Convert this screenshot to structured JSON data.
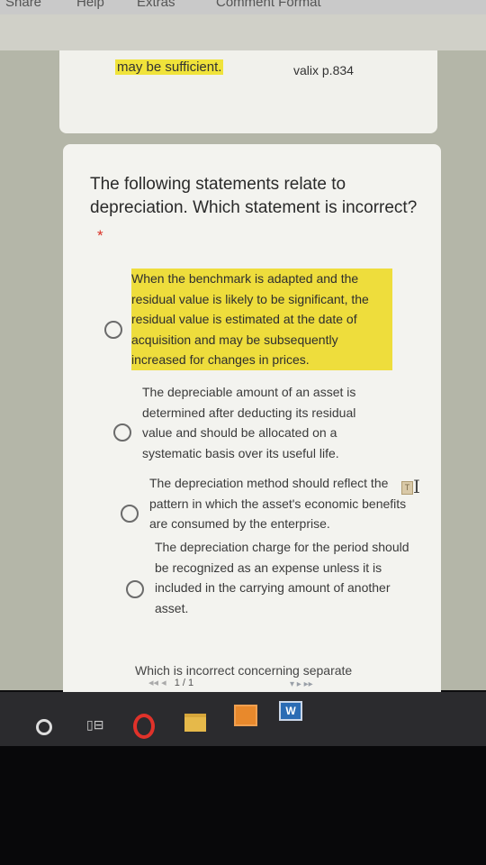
{
  "menu": {
    "items": [
      "Share",
      "Help",
      "Extras",
      "Comment Format"
    ]
  },
  "card1": {
    "highlighted_text": "may be sufficient.",
    "reference": "valix p.834"
  },
  "question": {
    "text": "The following statements relate to depreciation. Which statement is incorrect?",
    "required_marker": "*"
  },
  "options": [
    {
      "text": "When the benchmark is adapted and the residual value is likely to be significant, the residual value is estimated at the date of acquisition and may be subsequently increased for changes in prices.",
      "highlighted": true,
      "selected": false
    },
    {
      "text": "The depreciable amount of an asset is determined after deducting its residual value and should be allocated on a systematic basis over its useful life.",
      "highlighted": false,
      "selected": false
    },
    {
      "text": "The depreciation method should reflect the pattern in which the asset's economic benefits are consumed by the enterprise.",
      "highlighted": false,
      "selected": false
    },
    {
      "text": "The depreciation charge for the period should be recognized as an expense unless it is included in the carrying amount of another asset.",
      "highlighted": false,
      "selected": false
    }
  ],
  "next_question_preview": "Which is incorrect concerning separate",
  "pager": {
    "current": "1 / 1"
  },
  "taskbar": {
    "word_label": "W"
  },
  "colors": {
    "highlight": "#eedd3c",
    "required": "#d93025",
    "form_background": "#f3f3ef"
  }
}
